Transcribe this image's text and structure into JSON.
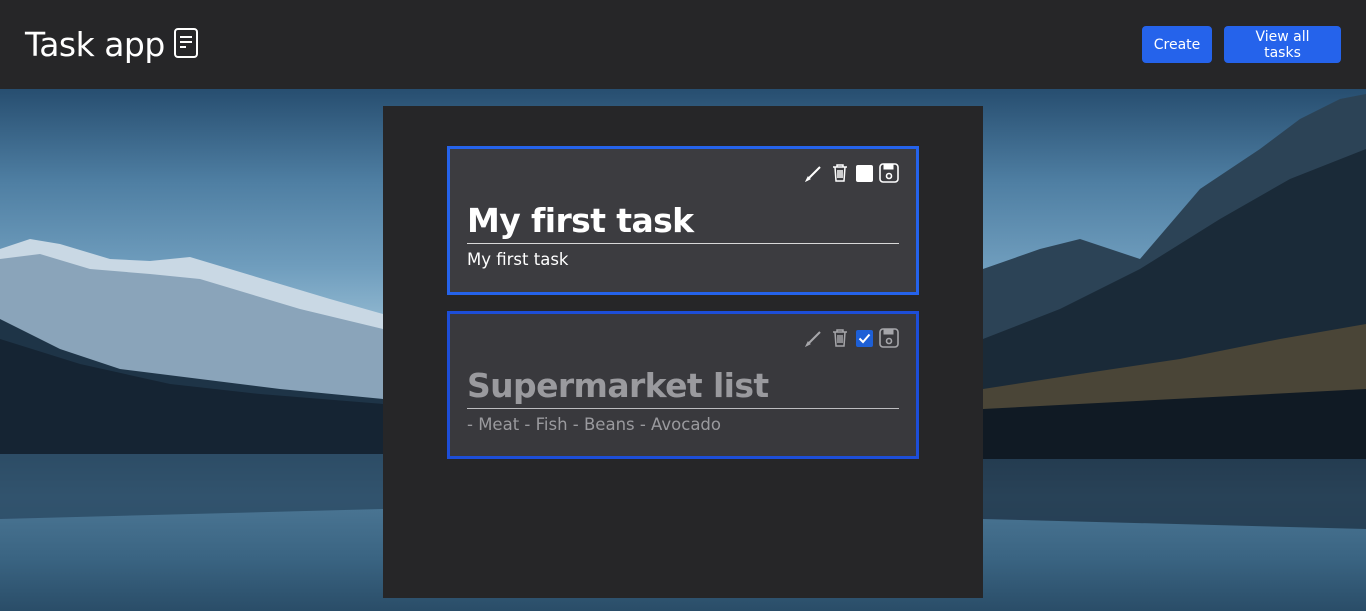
{
  "app": {
    "title": "Task app",
    "brand_icon": "document-icon"
  },
  "nav": {
    "create_label": "Create",
    "view_all_label": "View all tasks"
  },
  "colors": {
    "accent": "#2563eb",
    "panel": "#262628",
    "card": "#3c3c40"
  },
  "tasks": [
    {
      "title": "My first task",
      "description": "My first task",
      "completed": false
    },
    {
      "title": "Supermarket list",
      "description": "- Meat - Fish - Beans - Avocado",
      "completed": true
    }
  ],
  "card_tools": [
    "edit-icon",
    "trash-icon",
    "complete-checkbox",
    "save-icon"
  ]
}
